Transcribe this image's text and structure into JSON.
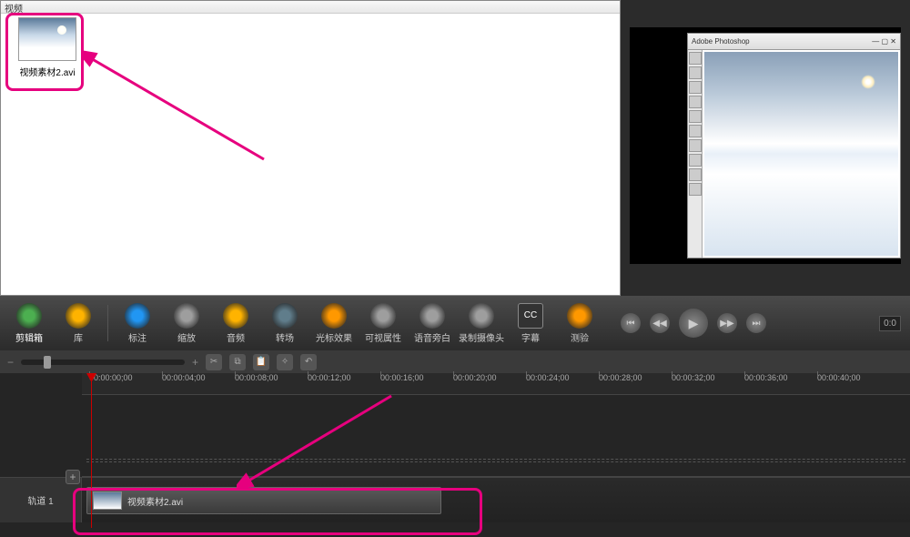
{
  "mediaBin": {
    "header": "视频",
    "item": {
      "name": "视频素材2.avi"
    }
  },
  "toolbar": [
    {
      "id": "clip-bin",
      "label": "剪辑箱",
      "color": "#4caf50"
    },
    {
      "id": "library",
      "label": "库",
      "color": "#ffb300"
    },
    {
      "id": "callouts",
      "label": "标注",
      "color": "#2196f3"
    },
    {
      "id": "zoom",
      "label": "缩放",
      "color": "#9e9e9e"
    },
    {
      "id": "audio",
      "label": "音频",
      "color": "#ffb300"
    },
    {
      "id": "transitions",
      "label": "转场",
      "color": "#607d8b"
    },
    {
      "id": "cursor-fx",
      "label": "光标效果",
      "color": "#ff9800"
    },
    {
      "id": "visual-props",
      "label": "可视属性",
      "color": "#9e9e9e"
    },
    {
      "id": "voice",
      "label": "语音旁白",
      "color": "#9e9e9e"
    },
    {
      "id": "record-cam",
      "label": "录制摄像头",
      "color": "#9e9e9e"
    },
    {
      "id": "captions",
      "label": "字幕",
      "color": "#9e9e9e",
      "text": "CC"
    },
    {
      "id": "quiz",
      "label": "测验",
      "color": "#ff9800"
    }
  ],
  "ruler": [
    "00:00:00;00",
    "00:00:04;00",
    "00:00:08;00",
    "00:00:12;00",
    "00:00:16;00",
    "00:00:20;00",
    "00:00:24;00",
    "00:00:28;00",
    "00:00:32;00",
    "00:00:36;00",
    "00:00:40;00"
  ],
  "track1": {
    "label": "轨道 1",
    "clipName": "视频素材2.avi"
  },
  "preview": {
    "time": "0:0",
    "psTitle": "Adobe Photoshop"
  }
}
